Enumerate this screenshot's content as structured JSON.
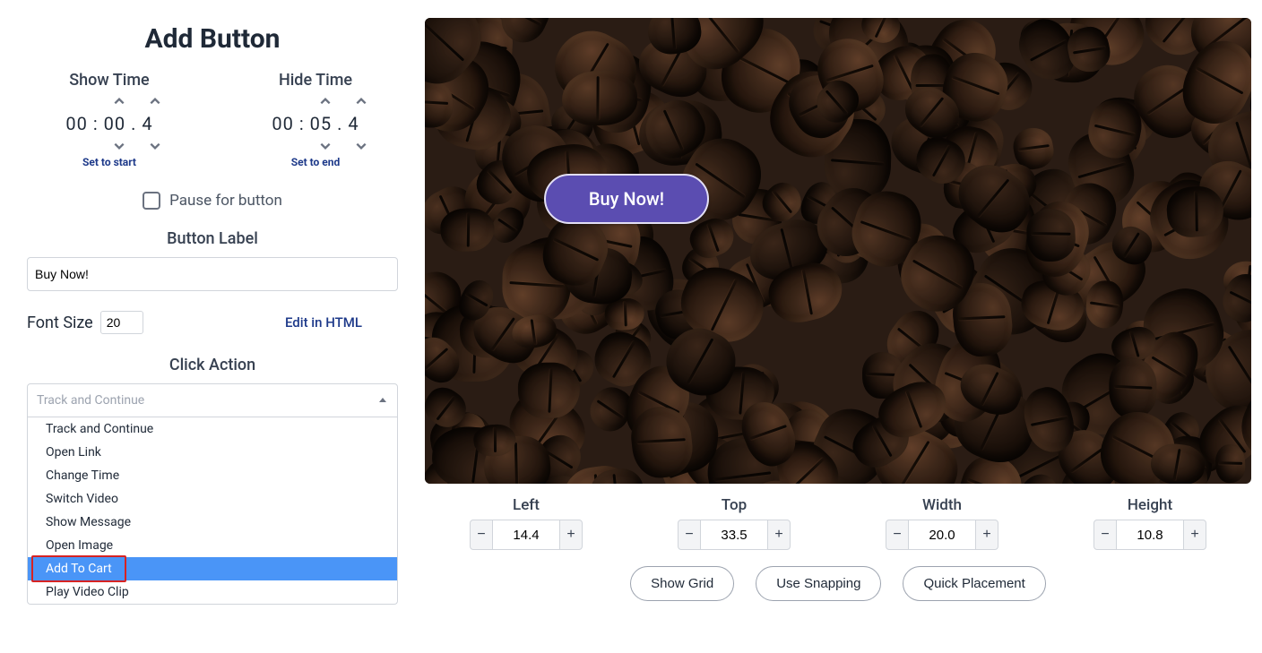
{
  "title": "Add Button",
  "show_time": {
    "label": "Show Time",
    "value": "00  :  00  .  4",
    "set_link": "Set to start"
  },
  "hide_time": {
    "label": "Hide Time",
    "value": "00  :  05  .  4",
    "set_link": "Set to end"
  },
  "pause_label": "Pause for button",
  "button_label_section": "Button Label",
  "button_label_value": "Buy Now!",
  "font_size_label": "Font Size",
  "font_size_value": "20",
  "edit_html": "Edit in HTML",
  "click_action_label": "Click Action",
  "click_action_placeholder": "Track and Continue",
  "click_action_options": [
    "Track and Continue",
    "Open Link",
    "Change Time",
    "Switch Video",
    "Show Message",
    "Open Image",
    "Add To Cart",
    "Play Video Clip"
  ],
  "click_action_selected_index": 6,
  "preview_button_text": "Buy Now!",
  "position": {
    "left": {
      "label": "Left",
      "value": "14.4"
    },
    "top": {
      "label": "Top",
      "value": "33.5"
    },
    "width": {
      "label": "Width",
      "value": "20.0"
    },
    "height": {
      "label": "Height",
      "value": "10.8"
    }
  },
  "bottom_buttons": {
    "grid": "Show Grid",
    "snap": "Use Snapping",
    "quick": "Quick Placement"
  }
}
